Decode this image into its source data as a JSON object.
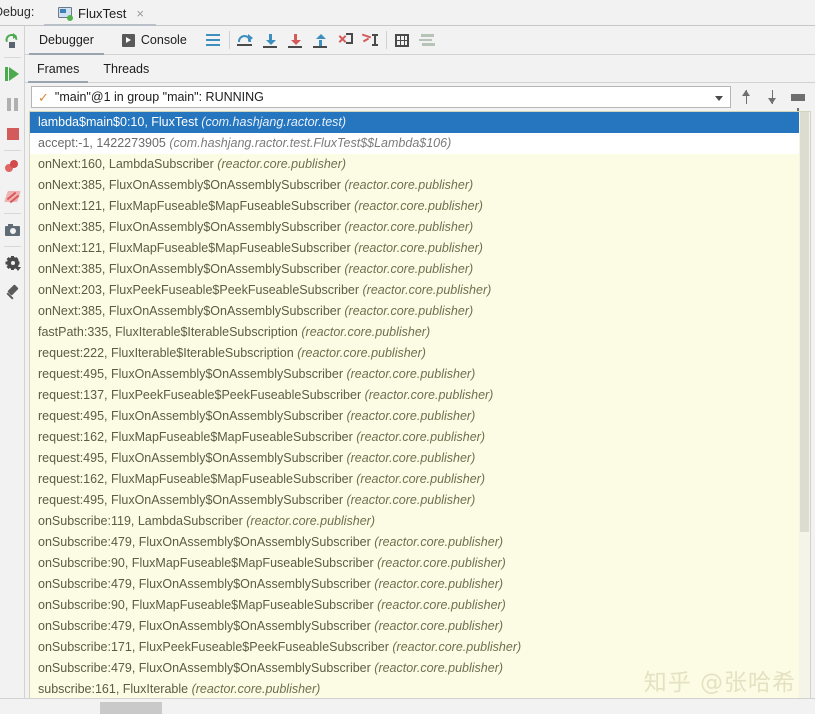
{
  "window": {
    "debug_label": "Debug:",
    "tab_title": "FluxTest",
    "tab_close": "×",
    "runconfig_icon": "run-configuration-icon"
  },
  "left_toolbar": {
    "items": [
      {
        "name": "rerun-button",
        "tooltip": "Rerun"
      },
      {
        "name": "resume-program-button",
        "tooltip": "Resume Program"
      },
      {
        "name": "pause-program-button",
        "tooltip": "Pause Program"
      },
      {
        "name": "stop-button",
        "tooltip": "Stop"
      },
      {
        "name": "view-breakpoints-button",
        "tooltip": "View Breakpoints"
      },
      {
        "name": "mute-breakpoints-button",
        "tooltip": "Mute Breakpoints"
      },
      {
        "name": "screenshot-button",
        "tooltip": "Screenshot"
      },
      {
        "name": "settings-button",
        "tooltip": "Settings"
      },
      {
        "name": "pin-tab-button",
        "tooltip": "Pin Tab"
      }
    ]
  },
  "toolbar": {
    "debugger_tab": "Debugger",
    "console_tab": "Console",
    "buttons": [
      {
        "name": "layout-settings-button",
        "icon": "lines-icon"
      },
      {
        "name": "step-over-button",
        "icon": "step-over-icon"
      },
      {
        "name": "step-into-button",
        "icon": "step-into-icon"
      },
      {
        "name": "force-step-into-button",
        "icon": "force-step-into-icon"
      },
      {
        "name": "step-out-button",
        "icon": "step-out-icon"
      },
      {
        "name": "drop-frame-button",
        "icon": "drop-frame-icon"
      },
      {
        "name": "run-to-cursor-button",
        "icon": "run-to-cursor-icon"
      },
      {
        "name": "evaluate-expression-button",
        "icon": "grid-icon"
      },
      {
        "name": "settings-filter-button",
        "icon": "filter-lines-icon"
      }
    ]
  },
  "subtabs": {
    "frames": "Frames",
    "threads": "Threads"
  },
  "thread_selector": {
    "check_glyph": "✓",
    "value": "\"main\"@1 in group \"main\": RUNNING",
    "up_button": "move-up-button",
    "down_button": "move-down-button",
    "filter_button": "filter-button"
  },
  "frames_list": {
    "rows": [
      {
        "method": "lambda$main$0:10, FluxTest",
        "package": "(com.hashjang.ractor.test)",
        "state": "selected"
      },
      {
        "method": "accept:-1, 1422273905",
        "package": "(com.hashjang.ractor.test.FluxTest$$Lambda$106)",
        "state": "white"
      },
      {
        "method": "onNext:160, LambdaSubscriber",
        "package": "(reactor.core.publisher)",
        "state": "normal"
      },
      {
        "method": "onNext:385, FluxOnAssembly$OnAssemblySubscriber",
        "package": "(reactor.core.publisher)",
        "state": "normal"
      },
      {
        "method": "onNext:121, FluxMapFuseable$MapFuseableSubscriber",
        "package": "(reactor.core.publisher)",
        "state": "normal"
      },
      {
        "method": "onNext:385, FluxOnAssembly$OnAssemblySubscriber",
        "package": "(reactor.core.publisher)",
        "state": "normal"
      },
      {
        "method": "onNext:121, FluxMapFuseable$MapFuseableSubscriber",
        "package": "(reactor.core.publisher)",
        "state": "normal"
      },
      {
        "method": "onNext:385, FluxOnAssembly$OnAssemblySubscriber",
        "package": "(reactor.core.publisher)",
        "state": "normal"
      },
      {
        "method": "onNext:203, FluxPeekFuseable$PeekFuseableSubscriber",
        "package": "(reactor.core.publisher)",
        "state": "normal"
      },
      {
        "method": "onNext:385, FluxOnAssembly$OnAssemblySubscriber",
        "package": "(reactor.core.publisher)",
        "state": "normal"
      },
      {
        "method": "fastPath:335, FluxIterable$IterableSubscription",
        "package": "(reactor.core.publisher)",
        "state": "normal"
      },
      {
        "method": "request:222, FluxIterable$IterableSubscription",
        "package": "(reactor.core.publisher)",
        "state": "normal"
      },
      {
        "method": "request:495, FluxOnAssembly$OnAssemblySubscriber",
        "package": "(reactor.core.publisher)",
        "state": "normal"
      },
      {
        "method": "request:137, FluxPeekFuseable$PeekFuseableSubscriber",
        "package": "(reactor.core.publisher)",
        "state": "normal"
      },
      {
        "method": "request:495, FluxOnAssembly$OnAssemblySubscriber",
        "package": "(reactor.core.publisher)",
        "state": "normal"
      },
      {
        "method": "request:162, FluxMapFuseable$MapFuseableSubscriber",
        "package": "(reactor.core.publisher)",
        "state": "normal"
      },
      {
        "method": "request:495, FluxOnAssembly$OnAssemblySubscriber",
        "package": "(reactor.core.publisher)",
        "state": "normal"
      },
      {
        "method": "request:162, FluxMapFuseable$MapFuseableSubscriber",
        "package": "(reactor.core.publisher)",
        "state": "normal"
      },
      {
        "method": "request:495, FluxOnAssembly$OnAssemblySubscriber",
        "package": "(reactor.core.publisher)",
        "state": "normal"
      },
      {
        "method": "onSubscribe:119, LambdaSubscriber",
        "package": "(reactor.core.publisher)",
        "state": "normal"
      },
      {
        "method": "onSubscribe:479, FluxOnAssembly$OnAssemblySubscriber",
        "package": "(reactor.core.publisher)",
        "state": "normal"
      },
      {
        "method": "onSubscribe:90, FluxMapFuseable$MapFuseableSubscriber",
        "package": "(reactor.core.publisher)",
        "state": "normal"
      },
      {
        "method": "onSubscribe:479, FluxOnAssembly$OnAssemblySubscriber",
        "package": "(reactor.core.publisher)",
        "state": "normal"
      },
      {
        "method": "onSubscribe:90, FluxMapFuseable$MapFuseableSubscriber",
        "package": "(reactor.core.publisher)",
        "state": "normal"
      },
      {
        "method": "onSubscribe:479, FluxOnAssembly$OnAssemblySubscriber",
        "package": "(reactor.core.publisher)",
        "state": "normal"
      },
      {
        "method": "onSubscribe:171, FluxPeekFuseable$PeekFuseableSubscriber",
        "package": "(reactor.core.publisher)",
        "state": "normal"
      },
      {
        "method": "onSubscribe:479, FluxOnAssembly$OnAssemblySubscriber",
        "package": "(reactor.core.publisher)",
        "state": "normal"
      },
      {
        "method": "subscribe:161, FluxIterable",
        "package": "(reactor.core.publisher)",
        "state": "normal"
      }
    ]
  },
  "watermark": {
    "text": "知乎 @张哈希"
  },
  "colors": {
    "selection": "#2675bf",
    "list_background": "#fcfce4",
    "chrome": "#f2f2f2",
    "accent_blue": "#3d8fc0",
    "accent_green": "#4eaa4e",
    "accent_red": "#d45b5b"
  }
}
